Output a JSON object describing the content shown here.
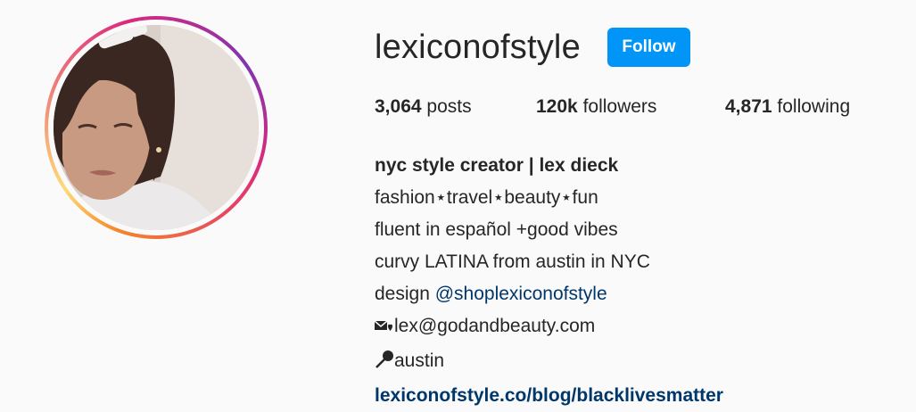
{
  "profile": {
    "username": "lexiconofstyle",
    "follow_label": "Follow",
    "accent_color": "#0095f6",
    "avatar_ring_colors": [
      "#f58529",
      "#dd2a7b",
      "#8134af"
    ]
  },
  "stats": {
    "posts_count": "3,064",
    "posts_label": "posts",
    "followers_count": "120k",
    "followers_label": "followers",
    "following_count": "4,871",
    "following_label": "following"
  },
  "bio": {
    "name": "nyc style creator | lex dieck",
    "line1": "fashion⋆travel⋆beauty⋆fun",
    "line2": "fluent in español +good vibes",
    "line3": "curvy LATINA from austin in NYC",
    "line4_prefix": "design ",
    "line4_mention": "@shoplexiconofstyle",
    "email_icon": "envelope-heart-icon",
    "email": "lex@godandbeauty.com",
    "location_icon": "pin-icon",
    "location": "austin",
    "website": "lexiconofstyle.co/blog/blacklivesmatter"
  }
}
